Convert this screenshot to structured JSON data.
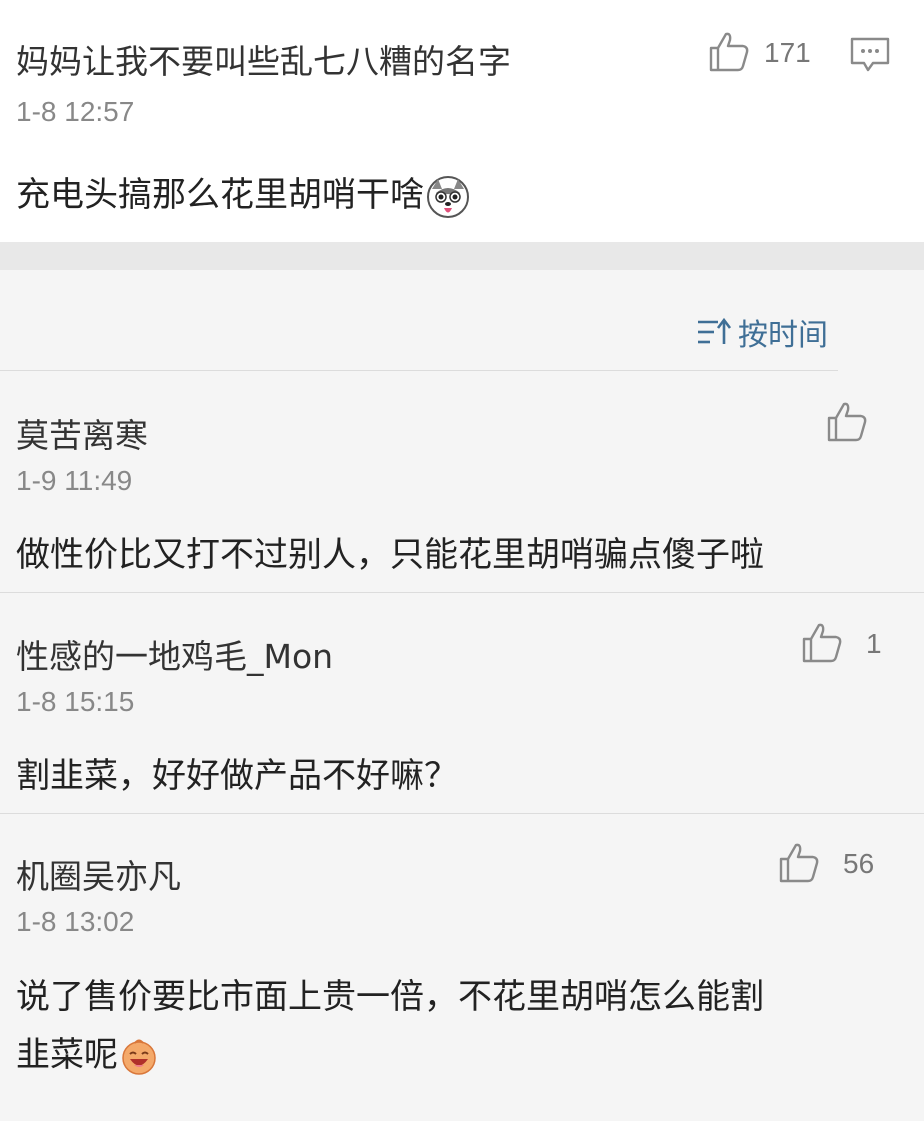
{
  "main_comment": {
    "author": "妈妈让我不要叫些乱七八糟的名字",
    "time": "1-8 12:57",
    "text": "充电头搞那么花里胡哨干啥",
    "like_count": "171",
    "emoji": "husky-face-emoji",
    "icons": {
      "like": "thumbs-up-icon",
      "reply": "comment-bubble-icon"
    }
  },
  "sort": {
    "label": "按时间",
    "icon": "sort-time-icon"
  },
  "replies": [
    {
      "author": "莫苦离寒",
      "time": "1-9 11:49",
      "text": "做性价比又打不过别人，只能花里胡哨骗点傻子啦",
      "like_count": ""
    },
    {
      "author": "性感的一地鸡毛_Mon",
      "time": "1-8 15:15",
      "text": "割韭菜，好好做产品不好嘛？",
      "like_count": "1"
    },
    {
      "author": "机圈吴亦凡",
      "time": "1-8 13:02",
      "text_line1": "说了售价要比市面上贵一倍，不花里胡哨怎么能割",
      "text_line2": "韭菜呢",
      "like_count": "56",
      "emoji": "laughing-face-emoji"
    }
  ],
  "colors": {
    "sort_accent": "#3f6f96",
    "icon_gray": "#8a8a8a",
    "time_gray": "#888888"
  }
}
